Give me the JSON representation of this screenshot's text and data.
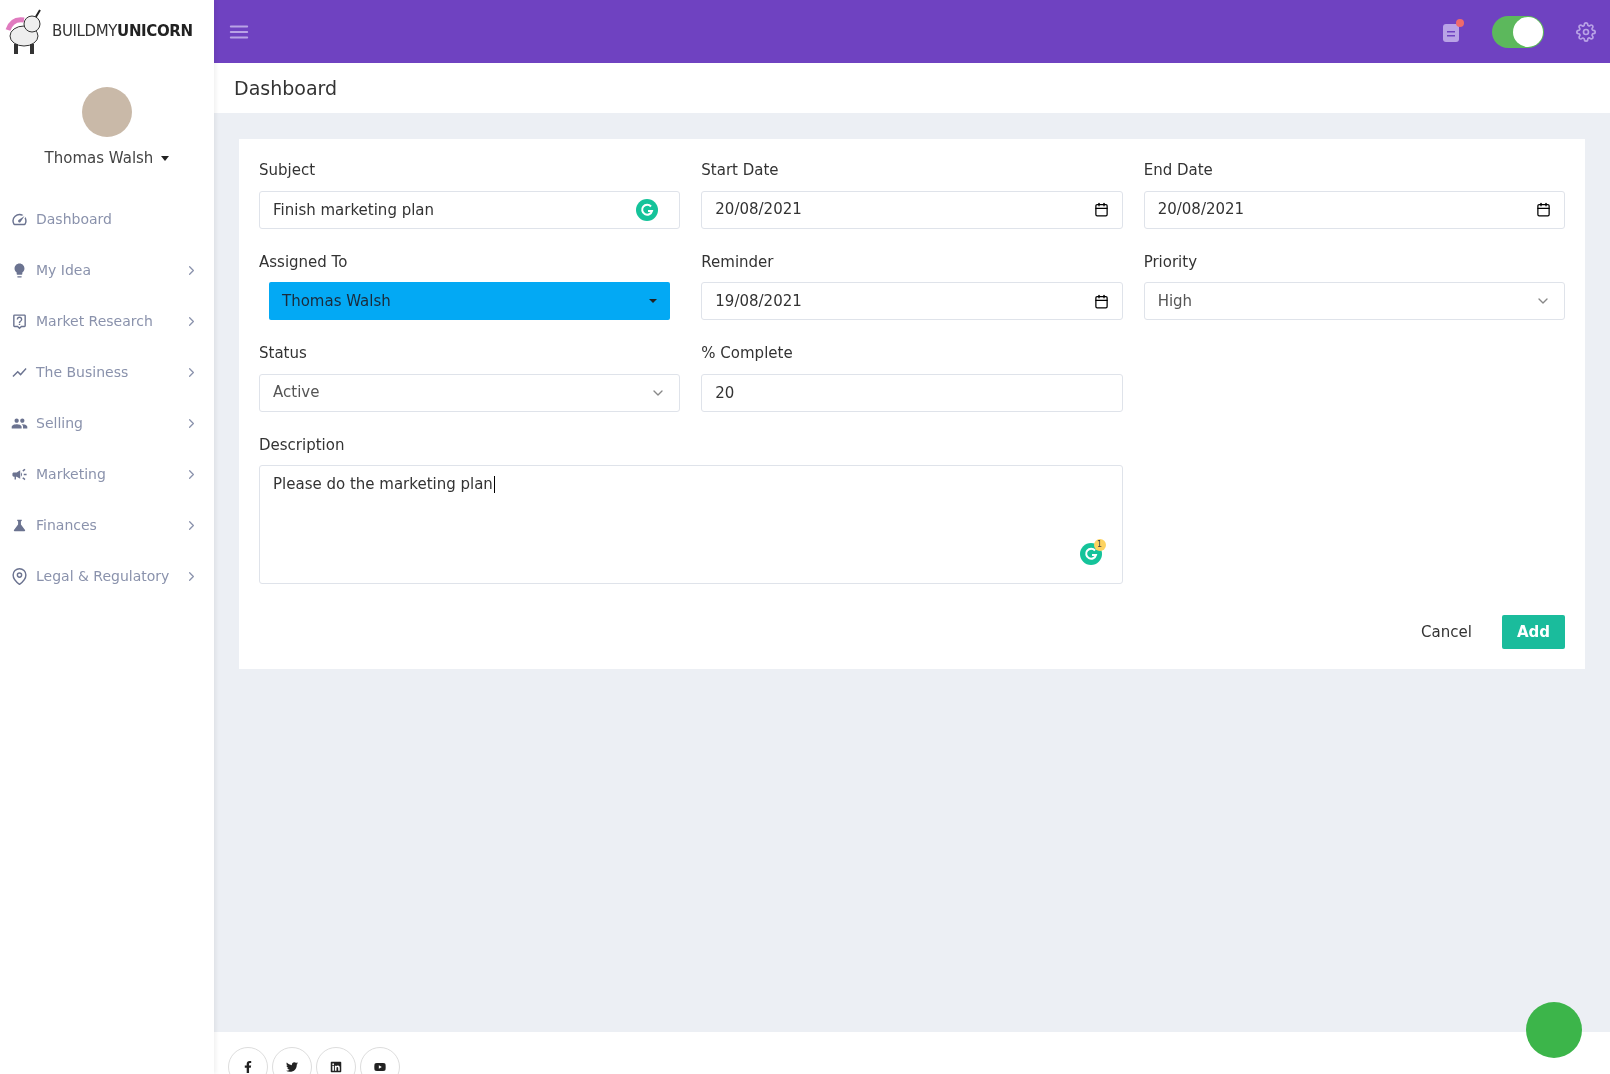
{
  "brand": {
    "light": "BUILDMY",
    "bold": "UNICORN"
  },
  "user": {
    "name": "Thomas Walsh"
  },
  "sidebar": {
    "items": [
      {
        "label": "Dashboard",
        "has_children": false
      },
      {
        "label": "My Idea",
        "has_children": true
      },
      {
        "label": "Market Research",
        "has_children": true
      },
      {
        "label": "The Business",
        "has_children": true
      },
      {
        "label": "Selling",
        "has_children": true
      },
      {
        "label": "Marketing",
        "has_children": true
      },
      {
        "label": "Finances",
        "has_children": true
      },
      {
        "label": "Legal & Regulatory",
        "has_children": true
      }
    ]
  },
  "topbar": {
    "notification": true,
    "toggle_on": true
  },
  "page": {
    "title": "Dashboard"
  },
  "form": {
    "fields": [
      {
        "kind": "text",
        "label": "Subject",
        "value": "Finish marketing plan",
        "grammarly": true
      },
      {
        "kind": "date",
        "label": "Start Date",
        "value": "20/08/2021"
      },
      {
        "kind": "date",
        "label": "End Date",
        "value": "20/08/2021"
      },
      {
        "kind": "picker",
        "label": "Assigned To",
        "value": "Thomas Walsh"
      },
      {
        "kind": "date",
        "label": "Reminder",
        "value": "19/08/2021"
      },
      {
        "kind": "select",
        "label": "Priority",
        "value": "High"
      },
      {
        "kind": "select",
        "label": "Status",
        "value": "Active"
      },
      {
        "kind": "text",
        "label": "% Complete",
        "value": "20"
      },
      {
        "kind": "textarea",
        "label": "Description",
        "value": "Please do the marketing plan",
        "grammarly": true,
        "grammarly_count": "1"
      }
    ],
    "buttons": [
      {
        "kind": "plain",
        "label": "Cancel"
      },
      {
        "kind": "primary",
        "label": "Add"
      }
    ]
  }
}
